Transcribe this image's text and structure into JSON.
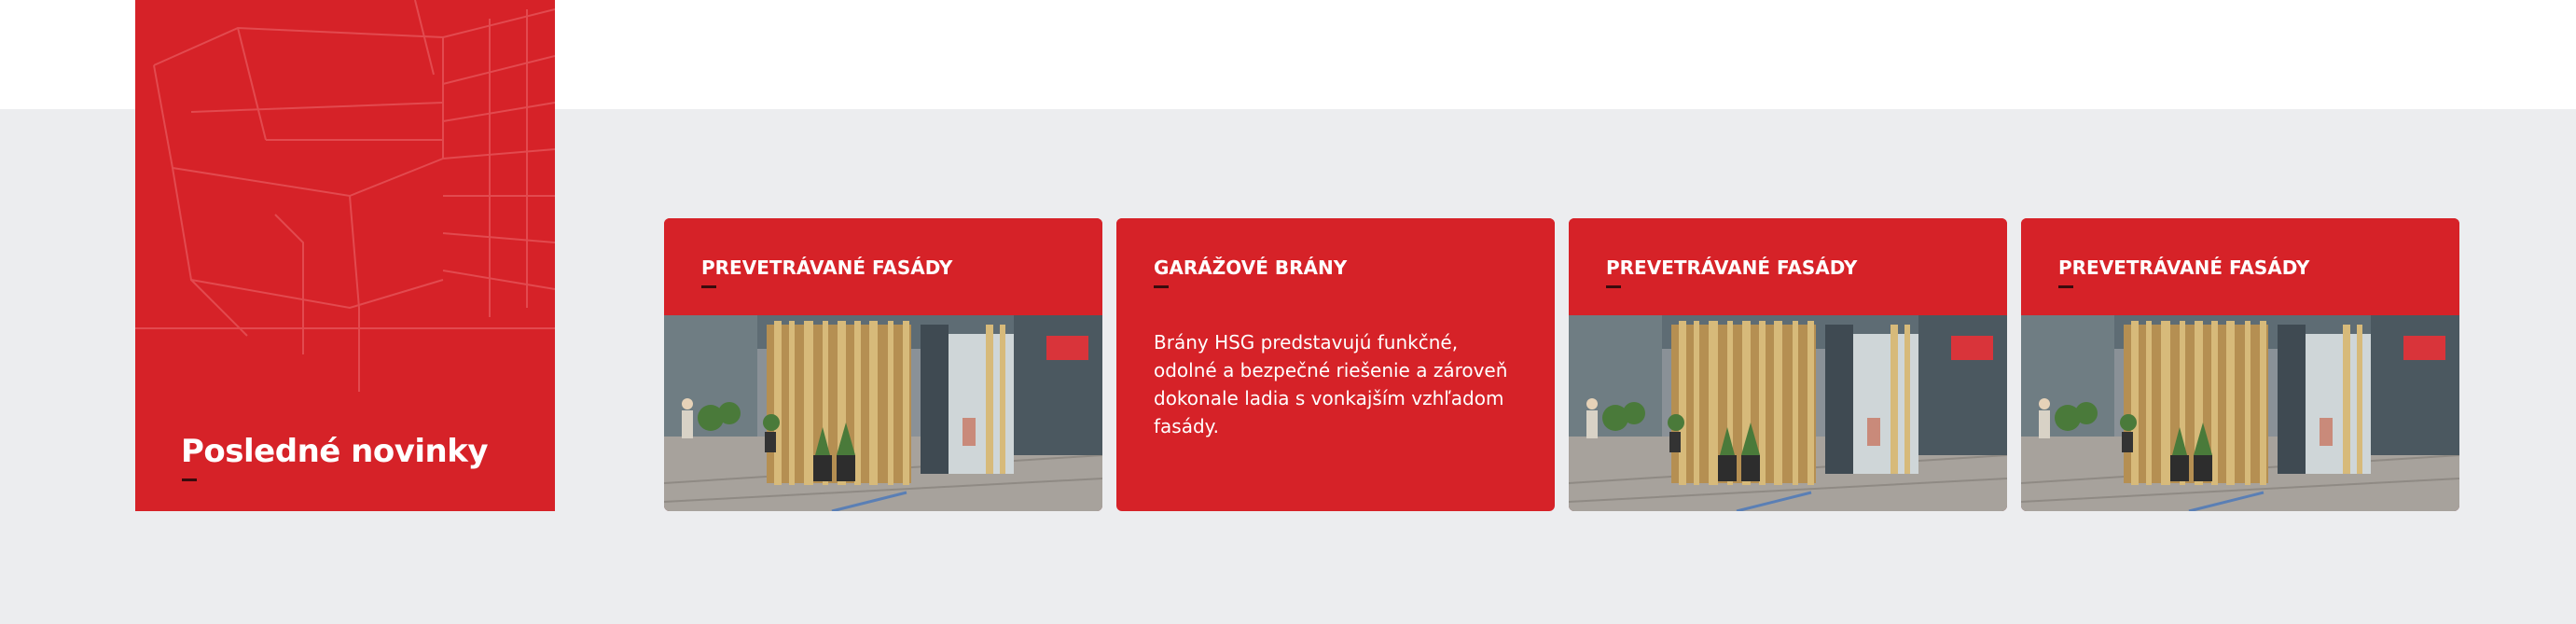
{
  "section": {
    "title": "Posledné novinky"
  },
  "cards": [
    {
      "title": "PREVETRÁVANÉ FASÁDY",
      "type": "image"
    },
    {
      "title": "GARÁŽOVÉ BRÁNY",
      "type": "text",
      "text": "Brány HSG predstavujú funkčné, odolné a bezpečné riešenie a zároveň dokonale ladia s vonkajším vzhľadom fasády."
    },
    {
      "title": "PREVETRÁVANÉ FASÁDY",
      "type": "image"
    },
    {
      "title": "PREVETRÁVANÉ FASÁDY",
      "type": "image"
    }
  ],
  "colors": {
    "brand_red": "#d62228",
    "band_grey": "#ecedef",
    "dash_dark": "#3a0b0d"
  }
}
